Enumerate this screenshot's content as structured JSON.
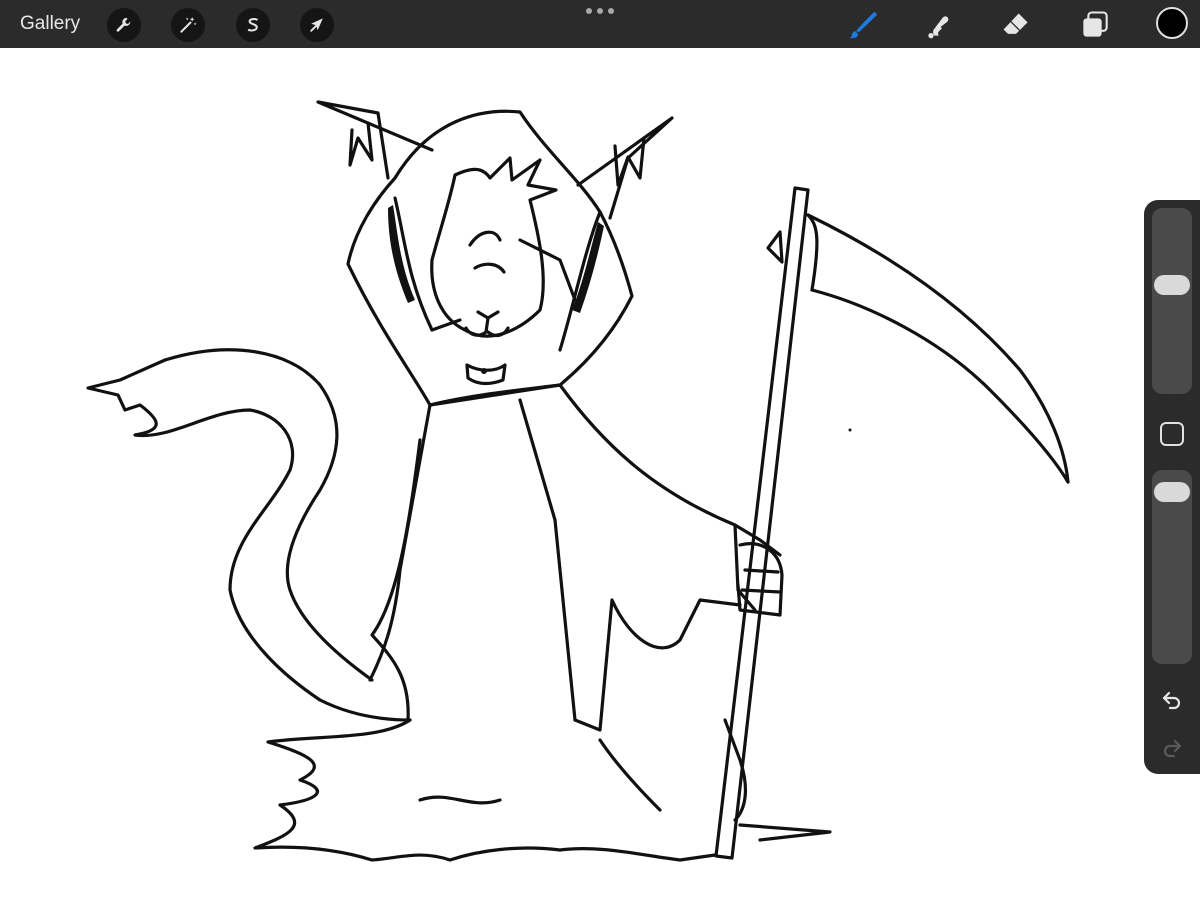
{
  "toolbar": {
    "gallery_label": "Gallery",
    "actions_icon": "wrench-icon",
    "adjustments_icon": "magic-wand-icon",
    "selection_icon": "selection-s-icon",
    "transform_icon": "arrow-cursor-icon",
    "tools": [
      "brush-icon",
      "smudge-icon",
      "eraser-icon",
      "layers-icon"
    ],
    "active_tool": "brush-icon",
    "active_color": "#000000",
    "accent_color": "#1f7ae0"
  },
  "sidebar": {
    "brush_size": 0.6,
    "brush_opacity": 0.95,
    "modifier_icon": "square-modifier-icon",
    "undo_icon": "undo-icon",
    "redo_icon": "redo-icon"
  },
  "canvas": {
    "drawing": "grim-reaper-cat-sketch",
    "background_color": "#ffffff"
  }
}
